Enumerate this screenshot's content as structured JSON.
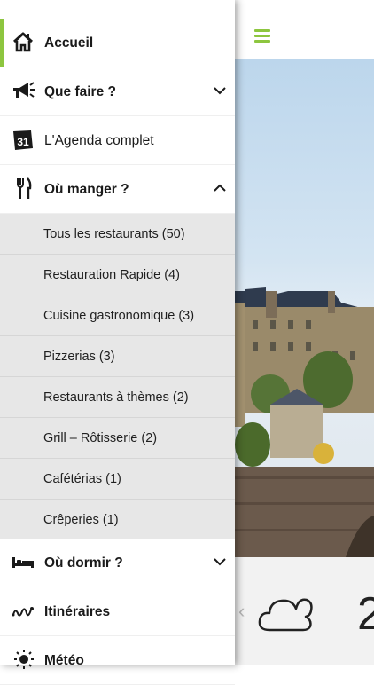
{
  "menu": {
    "items": [
      {
        "label": "Accueil",
        "icon": "home-icon"
      },
      {
        "label": "Que faire ?",
        "icon": "megaphone-icon"
      },
      {
        "label": "L'Agenda complet",
        "icon": "calendar-icon",
        "badge": "31"
      },
      {
        "label": "Où manger ?",
        "icon": "fork-knife-icon"
      },
      {
        "label": "Où dormir ?",
        "icon": "bed-icon"
      },
      {
        "label": "Itinéraires",
        "icon": "route-icon"
      },
      {
        "label": "Météo",
        "icon": "sun-icon"
      }
    ],
    "submenu": [
      "Tous les restaurants (50)",
      "Restauration Rapide (4)",
      "Cuisine gastronomique (3)",
      "Pizzerias (3)",
      "Restaurants à thèmes (2)",
      "Grill – Rôtisserie (2)",
      "Cafétérias (1)",
      "Crêperies (1)"
    ]
  },
  "weather": {
    "icon": "cloud-icon",
    "temp": "2"
  },
  "colors": {
    "accent": "#8dc63f",
    "submenu_bg": "#e7e7e7"
  }
}
